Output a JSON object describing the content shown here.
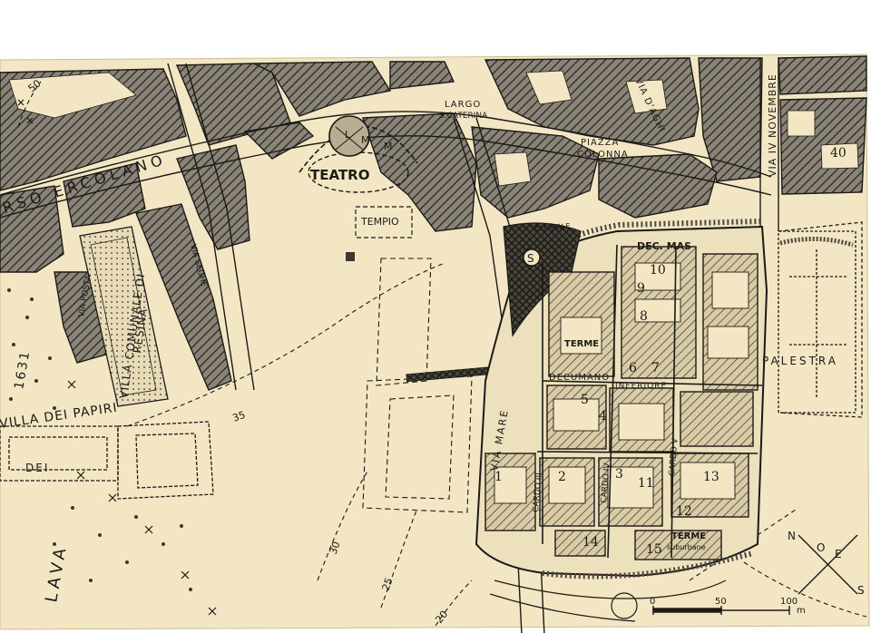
{
  "map": {
    "colors": {
      "paper": "#f2e6c4",
      "paper_dark": "#e6d6ac",
      "ink": "#1c1a16",
      "hatch_fill": "#7a746a",
      "background": "#ffffff"
    },
    "streets": {
      "corso_ercolano": "RSO ERCOLANO",
      "via_iv_novembre": "VIA IV NOVEMBRE",
      "via_dragh": "VIA D'AGHI",
      "largo_s_caterina_1": "LARGO",
      "largo_s_caterina_2": "S.CATERINA",
      "piazza_colonna_1": "PIAZZA",
      "piazza_colonna_2": "COLONNA",
      "via_mare": "VIA MARE",
      "via_posta": "VIA POSTA",
      "via_seghe": "VIA SEGHE",
      "via_ortale": "CO RTALE"
    },
    "areas": {
      "teatro": "TEATRO",
      "tempio": "TEMPIO",
      "villa_comunale_1": "VILLA COMUNALE DI",
      "villa_comunale_2": "RESINA",
      "villa_dei_papiri": "VILLA DEI PAPIRI",
      "palestra": "PALESTRA",
      "terme": "TERME",
      "terme_suburbane_1": "TERME",
      "terme_suburbane_2": "suburbane",
      "lava": "LAVA",
      "year": "1631",
      "dei": "DEI",
      "dec_mas": "DEC. MAS",
      "decumano_inferiore_1": "DECUMANO",
      "decumano_inferiore_2": "INFERIORE",
      "cardo_iii": "CARDO III",
      "cardo_iv": "CARDO IV",
      "cardo_v": "CARDO V"
    },
    "theatre_letters": [
      "L",
      "M",
      "M"
    ],
    "symbol_s": "S",
    "insulae": [
      "1",
      "2",
      "3",
      "4",
      "5",
      "6",
      "7",
      "8",
      "9",
      "10",
      "11",
      "12",
      "13",
      "14",
      "15",
      "40"
    ],
    "contours": [
      "50",
      "35",
      "30",
      "25",
      "20"
    ],
    "scale": {
      "zero": "0",
      "mid": "50",
      "end": "100",
      "unit": "m"
    },
    "compass": [
      "N",
      "O",
      "E",
      "S"
    ]
  }
}
